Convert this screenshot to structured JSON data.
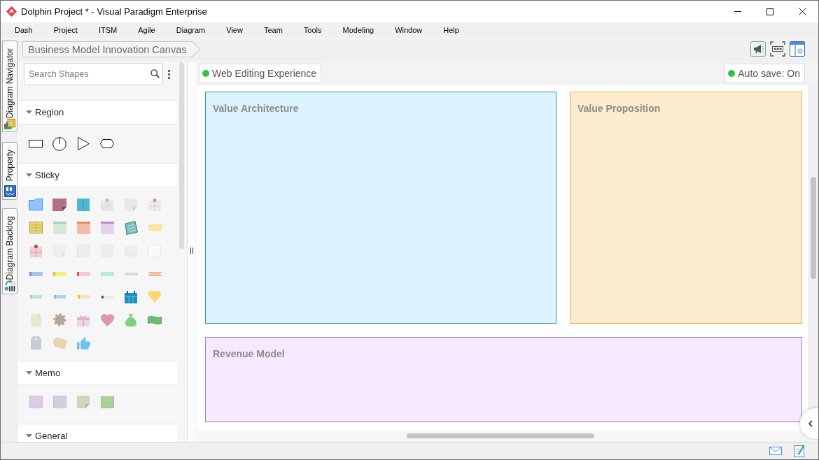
{
  "window": {
    "title": "Dolphin Project * - Visual Paradigm Enterprise"
  },
  "menu": [
    "Dash",
    "Project",
    "ITSM",
    "Agile",
    "Diagram",
    "View",
    "Team",
    "Tools",
    "Modeling",
    "Window",
    "Help"
  ],
  "side_tabs": [
    {
      "label": "Diagram Navigator"
    },
    {
      "label": "Property"
    },
    {
      "label": "Diagram Backlog"
    }
  ],
  "breadcrumb": [
    "Business Model Innovation Canvas"
  ],
  "palette": {
    "search": {
      "placeholder": "Search Shapes"
    },
    "sections": [
      {
        "kind": "region",
        "title": "Region",
        "expanded": true
      },
      {
        "kind": "sticky",
        "title": "Sticky",
        "expanded": true
      },
      {
        "kind": "memo",
        "title": "Memo",
        "expanded": true
      },
      {
        "kind": "general",
        "title": "General",
        "expanded": true
      }
    ]
  },
  "canvas": {
    "indicators": [
      {
        "label": "Web Editing Experience",
        "on": true
      },
      {
        "label": "Auto save: On",
        "on": true
      }
    ],
    "regions": [
      {
        "title": "Value Architecture",
        "color": "#3b8db5"
      },
      {
        "title": "Value Proposition",
        "color": "#e3ae3a"
      },
      {
        "title": "Revenue Model",
        "color": "#a47cc4"
      }
    ]
  }
}
